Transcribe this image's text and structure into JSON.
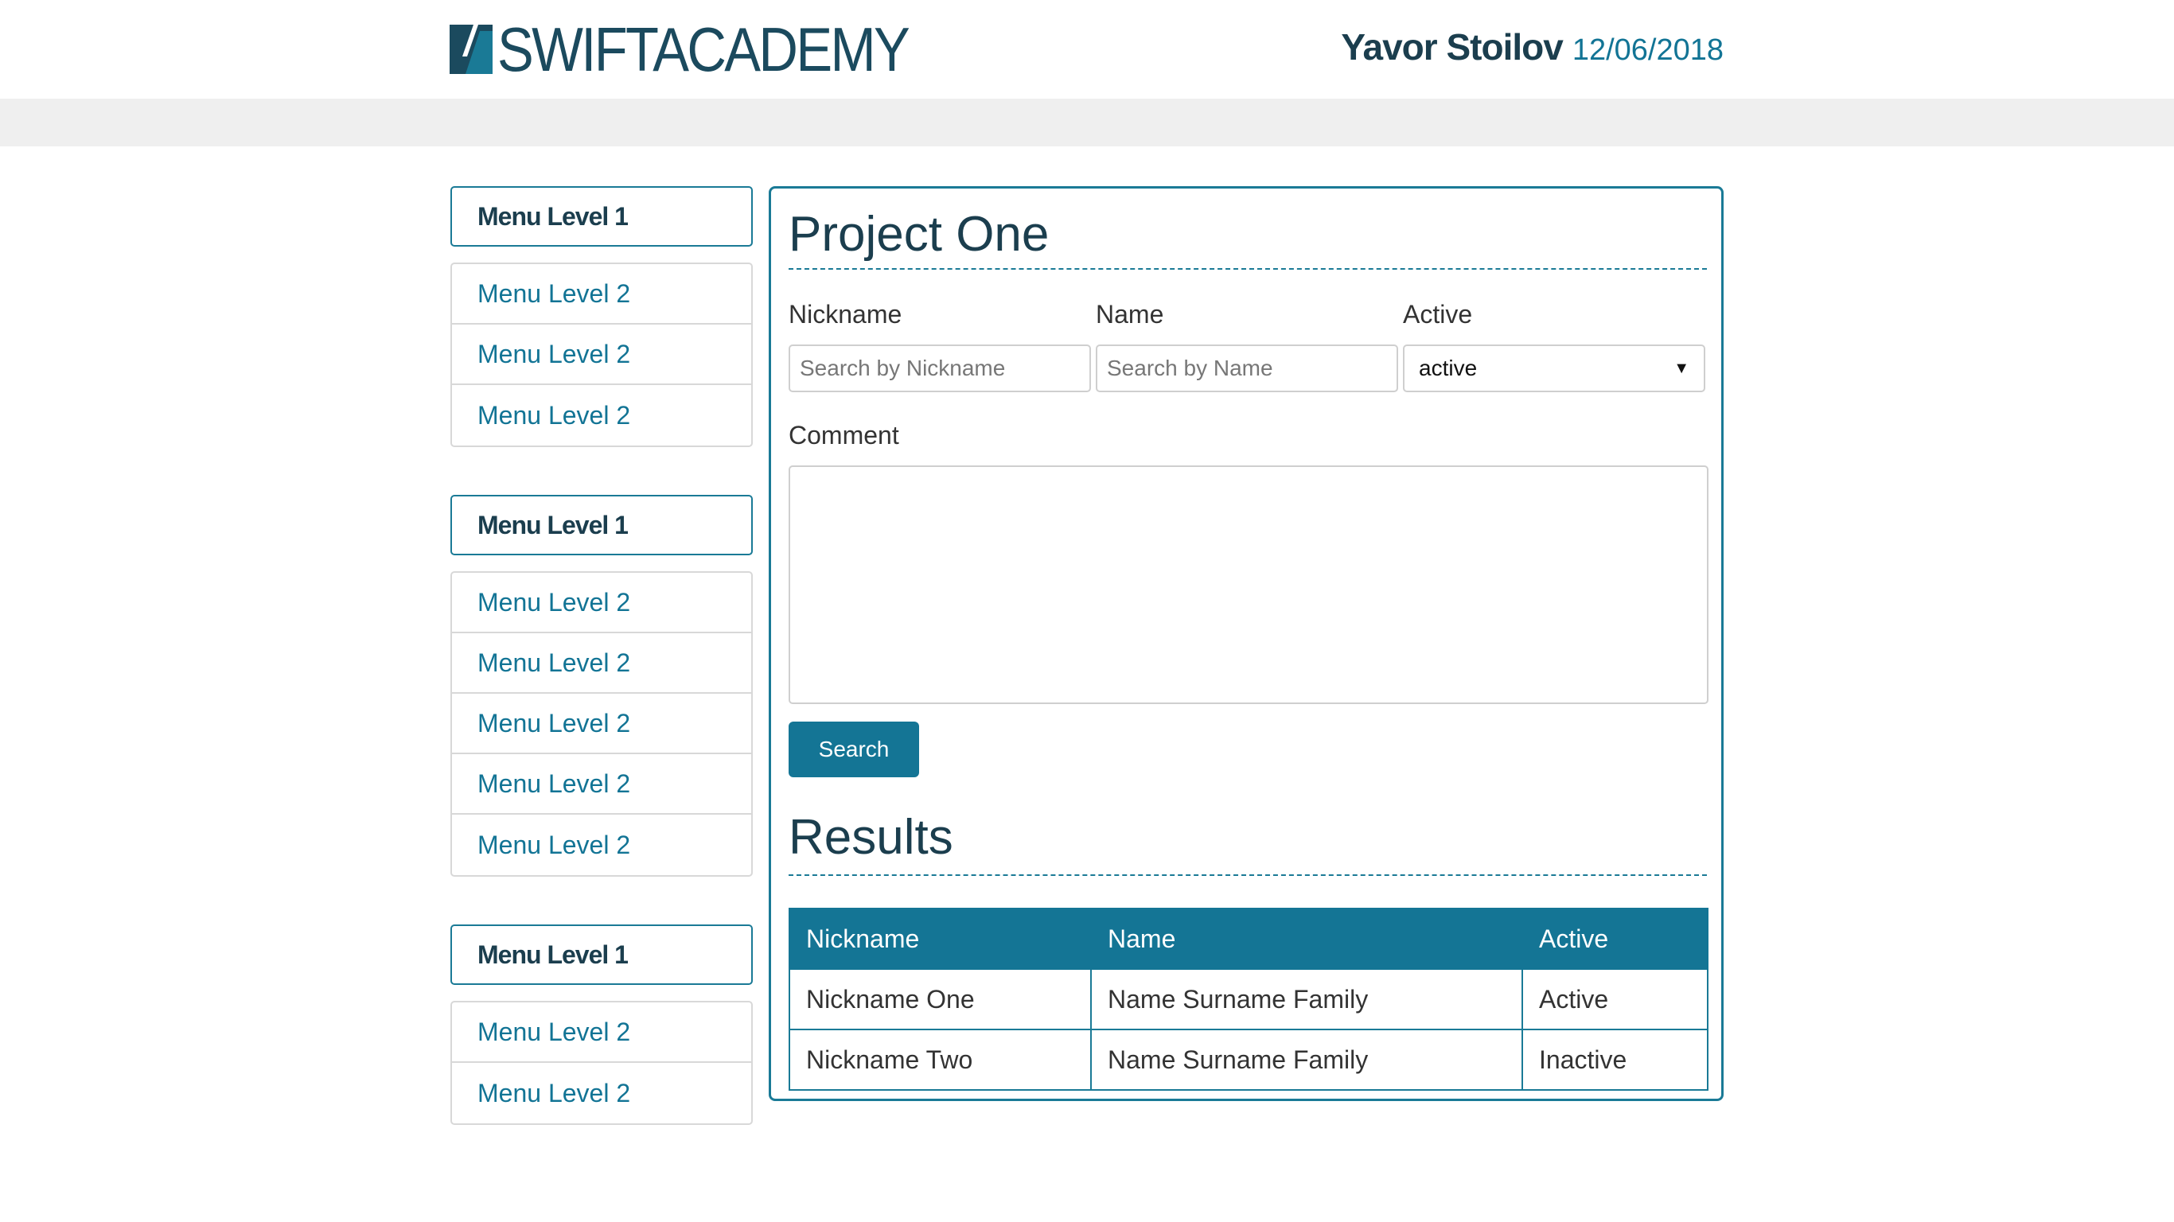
{
  "header": {
    "logo_text_bold": "SWIFT",
    "logo_text_light": "ACADEMY",
    "user_name": "Yavor Stoilov",
    "date": "12/06/2018"
  },
  "sidebar": {
    "groups": [
      {
        "title": "Menu Level 1",
        "items": [
          "Menu Level 2",
          "Menu Level 2",
          "Menu Level 2"
        ]
      },
      {
        "title": "Menu Level 1",
        "items": [
          "Menu Level 2",
          "Menu Level 2",
          "Menu Level 2",
          "Menu Level 2",
          "Menu Level 2"
        ]
      },
      {
        "title": "Menu Level 1",
        "items": [
          "Menu Level 2",
          "Menu Level 2"
        ]
      }
    ]
  },
  "form": {
    "title": "Project One",
    "nickname_label": "Nickname",
    "nickname_placeholder": "Search by Nickname",
    "nickname_value": "",
    "name_label": "Name",
    "name_placeholder": "Search by Name",
    "name_value": "",
    "active_label": "Active",
    "active_selected": "active",
    "comment_label": "Comment",
    "comment_value": "",
    "search_button": "Search"
  },
  "results": {
    "title": "Results",
    "columns": [
      "Nickname",
      "Name",
      "Active"
    ],
    "rows": [
      [
        "Nickname One",
        "Name Surname Family",
        "Active"
      ],
      [
        "Nickname Two",
        "Name Surname Family",
        "Inactive"
      ]
    ]
  },
  "colors": {
    "brand_dark": "#1b3e4e",
    "brand_accent": "#147595",
    "header_bar": "#efefef"
  },
  "icons": {
    "logo": "swift-academy-logo-icon",
    "select_arrow": "triangle-down-icon"
  }
}
